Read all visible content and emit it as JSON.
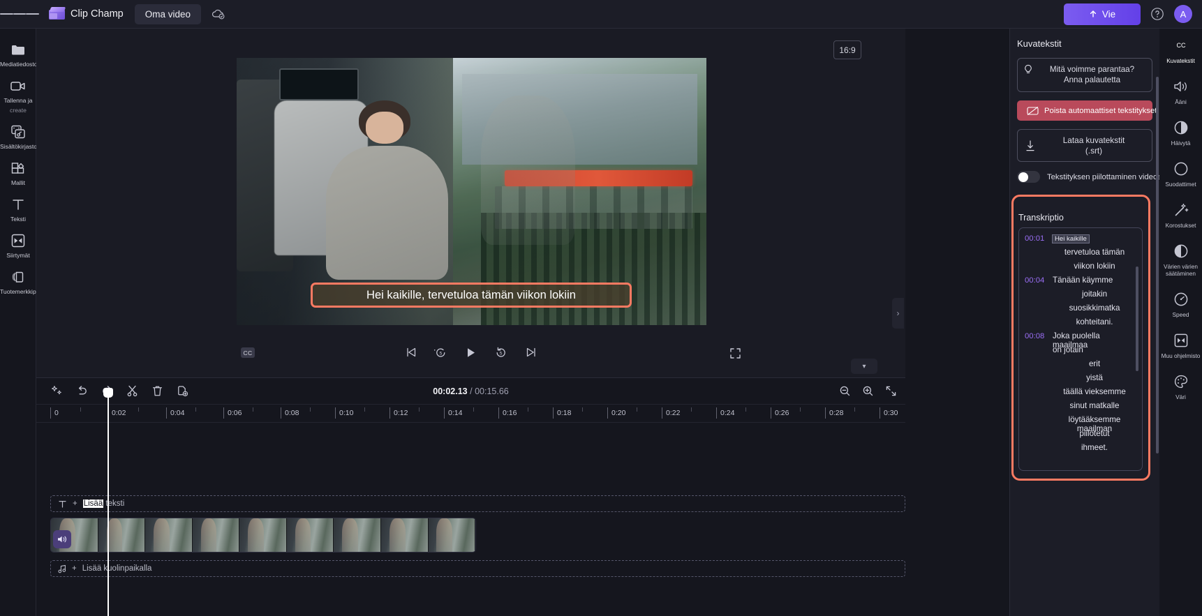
{
  "topbar": {
    "menu_icon": "hamburger-icon",
    "brand": "Clip Champ",
    "project_name": "Oma video",
    "cloud_icon": "cloud-saved-icon",
    "export_label": "Vie",
    "help_icon": "help-icon",
    "avatar_initial": "A"
  },
  "left_rail": [
    {
      "icon": "folder-icon",
      "label": "Mediatiedostosi",
      "label2": ""
    },
    {
      "icon": "video-camera-icon",
      "label": "Tallenna ja",
      "label2": "create"
    },
    {
      "icon": "content-library-icon",
      "label": "Sisältökirjasto",
      "label2": ""
    },
    {
      "icon": "templates-icon",
      "label": "Mallit",
      "label2": ""
    },
    {
      "icon": "text-icon",
      "label": "Teksti",
      "label2": ""
    },
    {
      "icon": "transitions-icon",
      "label": "Siirtymät",
      "label2": ""
    },
    {
      "icon": "brand-kit-icon",
      "label": "Tuotemerkkipaketti",
      "label2": ""
    }
  ],
  "preview": {
    "aspect_ratio": "16:9",
    "caption_text": "Hei kaikille, tervetuloa tämän viikon lokiin",
    "cc_label": "CC",
    "controls": [
      {
        "name": "skip-previous-button",
        "glyph": "prev"
      },
      {
        "name": "rewind-5-button",
        "glyph": "back5"
      },
      {
        "name": "play-button",
        "glyph": "play"
      },
      {
        "name": "forward-5-button",
        "glyph": "fwd5"
      },
      {
        "name": "skip-next-button",
        "glyph": "next"
      }
    ],
    "fullscreen_icon": "fullscreen-icon",
    "collapse_icon": "chevron-right-icon",
    "panel_collapse_icon": "chevron-down-icon"
  },
  "timeline": {
    "tools": [
      {
        "name": "magic-effects-button",
        "icon": "sparkle-icon"
      },
      {
        "name": "undo-button",
        "icon": "undo-icon"
      },
      {
        "name": "redo-button",
        "icon": "redo-icon"
      },
      {
        "name": "split-button",
        "icon": "scissors-icon"
      },
      {
        "name": "delete-button",
        "icon": "trash-icon"
      },
      {
        "name": "duplicate-button",
        "icon": "duplicate-icon"
      }
    ],
    "current_time": "00:02.13",
    "separator": "/",
    "total_time": "00:15.66",
    "zoom_out_icon": "zoom-out-icon",
    "zoom_in_icon": "zoom-in-icon",
    "fit_icon": "fit-timeline-icon",
    "ruler_ticks": [
      "0",
      "0:02",
      "0:04",
      "0:06",
      "0:08",
      "0:10",
      "0:12",
      "0:14",
      "0:16",
      "0:18",
      "0:20",
      "0:22",
      "0:24",
      "0:26",
      "0:28",
      "0:30"
    ],
    "text_track_label": "Lisää teksti",
    "text_track_selected": "Lisää",
    "audio_track_label": "Lisää kuolinpaikalla",
    "video_frames": 9
  },
  "right_panel": {
    "title": "Kuvatekstit",
    "feedback_line1": "Mitä voimme parantaa?",
    "feedback_line2": "Anna palautetta",
    "feedback_icon": "lightbulb-icon",
    "disable_captions_label": "Poista automaattiset tekstitykset käytöstä",
    "disable_icon": "captions-off-icon",
    "download_line1": "Lataa kuvatekstit",
    "download_line2": "(.srt)",
    "download_icon": "download-icon",
    "hide_captions_label": "Tekstityksen piilottaminen videossa",
    "hide_captions_on": false,
    "transcript_title": "Transkriptio",
    "highlight_color": "#fc7a62",
    "transcript": [
      {
        "time": "00:01",
        "text": "Hei kaikille",
        "align": "left",
        "selected": true
      },
      {
        "time": "",
        "text": "tervetuloa tämän",
        "align": "center"
      },
      {
        "time": "",
        "text": "viikon lokiin",
        "align": "center"
      },
      {
        "time": "00:04",
        "text": "Tänään käymme",
        "align": "left"
      },
      {
        "time": "",
        "text": "joitakin",
        "align": "center"
      },
      {
        "time": "",
        "text": "suosikkimatka",
        "align": "center"
      },
      {
        "time": "",
        "text": "kohteitani.",
        "align": "center"
      },
      {
        "time": "00:08",
        "text": "Joka puolella maailmaa",
        "align": "left"
      },
      {
        "time": "",
        "text": "on jotain",
        "align": "center"
      },
      {
        "time": "",
        "text": "erit",
        "align": "right"
      },
      {
        "time": "",
        "text": "yistä",
        "align": "right"
      },
      {
        "time": "",
        "text": "täällä vieksemme",
        "align": "center"
      },
      {
        "time": "",
        "text": "sinut matkalle",
        "align": "center"
      },
      {
        "time": "",
        "text": "löytääksemme maailman",
        "align": "center"
      },
      {
        "time": "",
        "text": "piilotetut",
        "align": "center"
      },
      {
        "time": "",
        "text": "ihmeet.",
        "align": "center"
      }
    ]
  },
  "far_rail": [
    {
      "icon": "captions-icon",
      "label": "Kuvatekstit",
      "active": true
    },
    {
      "icon": "speaker-icon",
      "label": "Ääni",
      "active": false
    },
    {
      "icon": "fade-icon",
      "label": "Häivytä",
      "active": false
    },
    {
      "icon": "filters-icon",
      "label": "Suodattimet",
      "active": false
    },
    {
      "icon": "magic-wand-icon",
      "label": "Korostukset",
      "active": false
    },
    {
      "icon": "contrast-icon",
      "label": "Värien värien säätäminen",
      "active": false
    },
    {
      "icon": "speedometer-icon",
      "label": "Speed",
      "active": false
    },
    {
      "icon": "transitions-icon",
      "label": "Muu ohjelmisto",
      "active": false
    },
    {
      "icon": "palette-icon",
      "label": "Väri",
      "active": false
    }
  ]
}
